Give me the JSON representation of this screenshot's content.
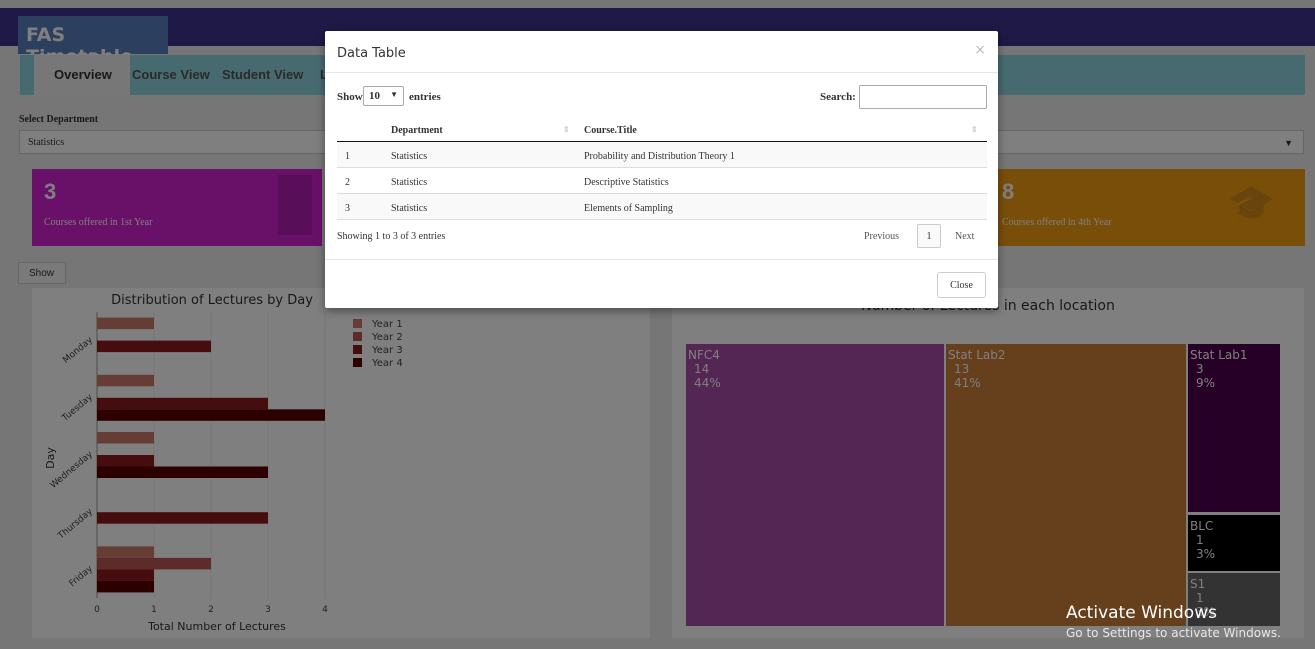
{
  "app": {
    "title": "FAS Timetable"
  },
  "tabs": [
    {
      "label": "Overview",
      "active": true
    },
    {
      "label": "Course View",
      "active": false
    },
    {
      "label": "Student View",
      "active": false
    },
    {
      "label": "L",
      "active": false
    }
  ],
  "department": {
    "label": "Select Department",
    "selected": "Statistics"
  },
  "cards": [
    {
      "value": "3",
      "label": "Courses offered in 1st Year",
      "color": "#d222d2"
    },
    {
      "value": "8",
      "label": "Courses offered in 4th Year",
      "color": "#f39c12"
    }
  ],
  "show_button": "Show",
  "bar_chart": {
    "title": "Distribution of Lectures by Day",
    "xlabel": "Total Number of Lectures",
    "ylabel": "Day",
    "days": [
      "Monday",
      "Tuesday",
      "Wednesday",
      "Thursday",
      "Friday"
    ],
    "xticks": [
      "0",
      "1",
      "2",
      "3",
      "4"
    ],
    "legend": [
      "Year 1",
      "Year 2",
      "Year 3",
      "Year 4"
    ]
  },
  "chart_data": {
    "type": "bar",
    "orientation": "horizontal",
    "categories": [
      "Monday",
      "Tuesday",
      "Wednesday",
      "Thursday",
      "Friday"
    ],
    "series": [
      {
        "name": "Year 1",
        "color": "#cc7a6a",
        "values": [
          1,
          1,
          1,
          0,
          1
        ]
      },
      {
        "name": "Year 2",
        "color": "#bf5555",
        "values": [
          0,
          0,
          0,
          0,
          2
        ]
      },
      {
        "name": "Year 3",
        "color": "#8a1a1a",
        "values": [
          2,
          3,
          1,
          3,
          1
        ]
      },
      {
        "name": "Year 4",
        "color": "#5a0000",
        "values": [
          0,
          4,
          3,
          0,
          1
        ]
      }
    ],
    "title": "Distribution of Lectures by Day",
    "xlabel": "Total Number of Lectures",
    "ylabel": "Day",
    "xlim": [
      0,
      4
    ]
  },
  "treemap": {
    "title": "Number of Lectures in each location",
    "tiles": [
      {
        "name": "NFC4",
        "count": "14",
        "pct": "44%",
        "color": "#a64ca6"
      },
      {
        "name": "Stat Lab2",
        "count": "13",
        "pct": "41%",
        "color": "#cc7f3a"
      },
      {
        "name": "Stat Lab1",
        "count": "3",
        "pct": "9%",
        "color": "#4d004d"
      },
      {
        "name": "BLC",
        "count": "1",
        "pct": "3%",
        "color": "#000000"
      },
      {
        "name": "S1",
        "count": "1",
        "pct": "3%",
        "color": "#666666"
      }
    ]
  },
  "modal": {
    "title": "Data Table",
    "close_x": "×",
    "show_label": "Show",
    "page_length": "10",
    "entries_label": "entries",
    "search_label": "Search:",
    "search_value": "",
    "columns": [
      "",
      "Department",
      "Course.Title"
    ],
    "rows": [
      [
        "1",
        "Statistics",
        "Probability and Distribution Theory 1"
      ],
      [
        "2",
        "Statistics",
        "Descriptive Statistics"
      ],
      [
        "3",
        "Statistics",
        "Elements of Sampling"
      ]
    ],
    "info": "Showing 1 to 3 of 3 entries",
    "previous": "Previous",
    "current_page": "1",
    "next": "Next",
    "close_button": "Close"
  },
  "windows_watermark": {
    "title": "Activate Windows",
    "subtitle": "Go to Settings to activate Windows."
  }
}
